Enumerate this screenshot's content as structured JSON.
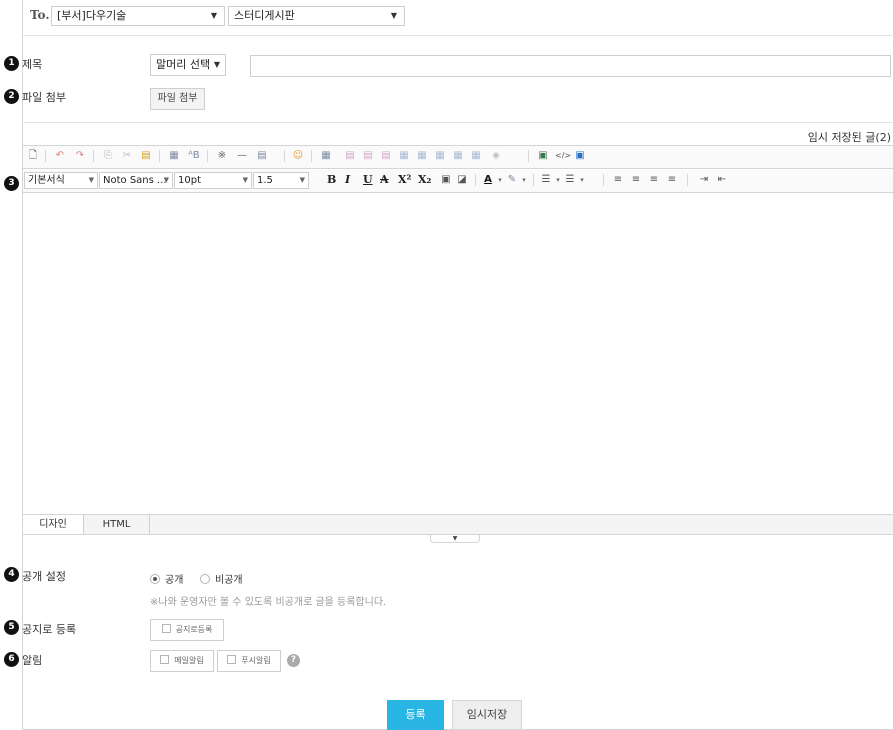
{
  "header": {
    "to_label": "To.",
    "department_select": "[부서]다우기술",
    "board_select": "스터디게시판"
  },
  "steps": [
    "1",
    "2",
    "3",
    "4",
    "5",
    "6"
  ],
  "title_row": {
    "label": "제목",
    "prefix_select": "말머리 선택",
    "title_input_value": ""
  },
  "attach_row": {
    "label": "파일 첨부",
    "button": "파일 첨부"
  },
  "temp_saved_link": "임시 저장된 글(2)",
  "editor": {
    "style_select": "기본서식",
    "font_select": "Noto Sans ...",
    "size_select": "10pt",
    "line_height_select": "1.5",
    "format_buttons": [
      "B",
      "I",
      "U",
      "A",
      "X²",
      "X₂"
    ],
    "tabs": [
      "디자인",
      "HTML"
    ],
    "active_tab": "디자인",
    "content": ""
  },
  "visibility": {
    "label": "공개 설정",
    "options": [
      "공개",
      "비공개"
    ],
    "selected": "공개",
    "note": "※나와 운영자만 볼 수 있도록 비공개로 글을 등록합니다."
  },
  "notice": {
    "label": "공지로 등록",
    "checkbox": "공지로등록"
  },
  "alarm": {
    "label": "알림",
    "mail_checkbox": "메일알림",
    "push_checkbox": "푸시알림",
    "help_icon": "?"
  },
  "actions": {
    "submit": "등록",
    "temp_save": "임시저장"
  },
  "colors": {
    "primary": "#29b6e4",
    "border": "#d5d5d5"
  }
}
